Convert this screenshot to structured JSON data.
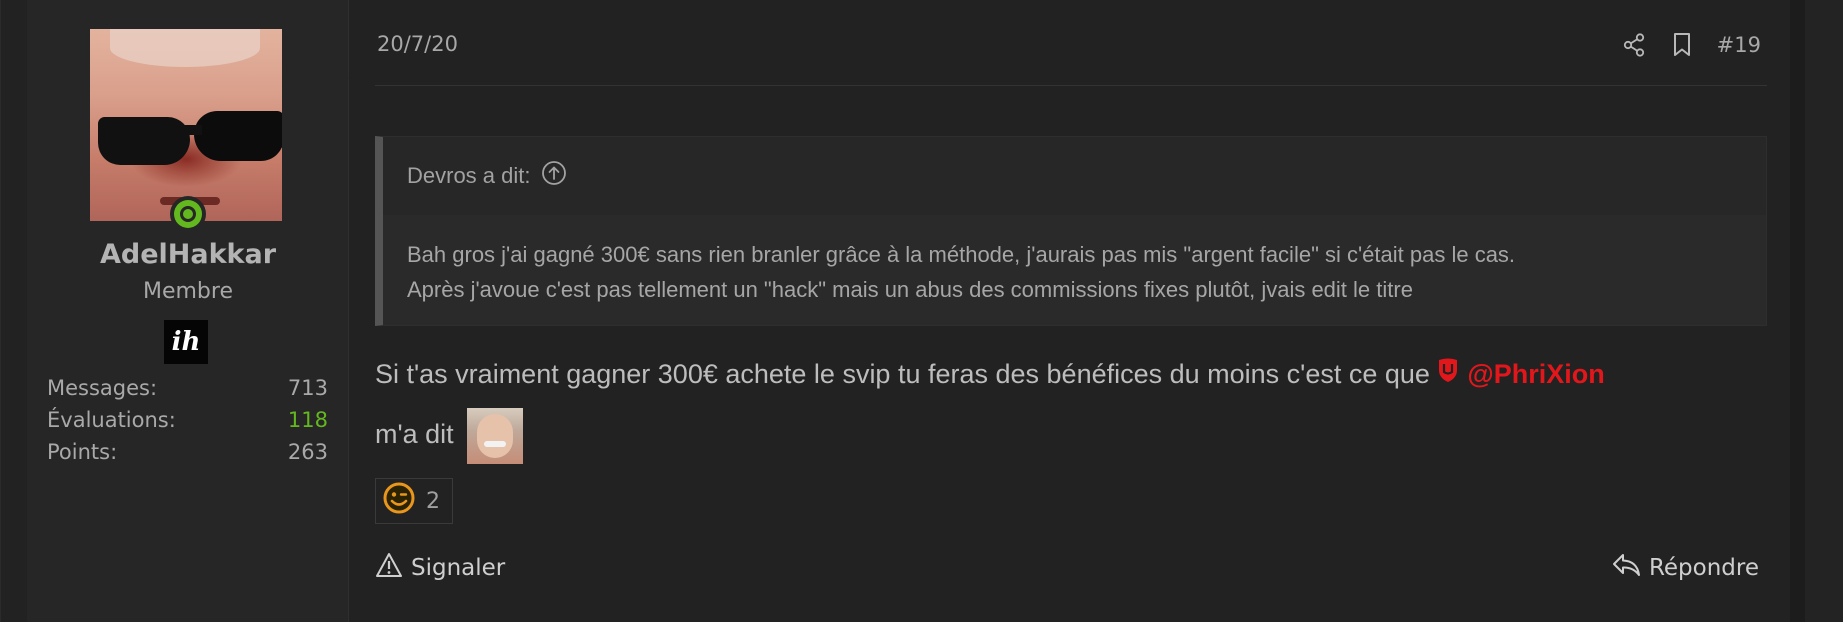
{
  "user": {
    "name": "AdelHakkar",
    "title": "Membre",
    "badge": "ih",
    "stats": [
      {
        "label": "Messages:",
        "value": "713",
        "positive": false
      },
      {
        "label": "Évaluations:",
        "value": "118",
        "positive": true
      },
      {
        "label": "Points:",
        "value": "263",
        "positive": false
      }
    ],
    "online": true
  },
  "post": {
    "date": "20/7/20",
    "number": "#19",
    "quote": {
      "author_line": "Devros a dit:",
      "lines": [
        "Bah gros j'ai gagné 300€ sans rien branler grâce à la méthode, j'aurais pas mis \"argent facile\" si c'était pas le cas.",
        "Après j'avoue c'est pas tellement un \"hack\" mais un abus des commissions fixes plutôt, jvais edit le titre"
      ]
    },
    "message": {
      "text_before": "Si t'as vraiment gagner 300€ achete le svip tu feras des bénéfices du moins c'est ce que ",
      "mention": "@PhriXion",
      "text_after": "m'a dit"
    },
    "reaction": {
      "icon": "smiley-wink-icon",
      "count": "2"
    },
    "actions": {
      "report": "Signaler",
      "reply": "Répondre"
    }
  },
  "colors": {
    "accent_green": "#63b81f",
    "mention_red": "#e2171c",
    "reaction_orange": "#e8961e"
  }
}
